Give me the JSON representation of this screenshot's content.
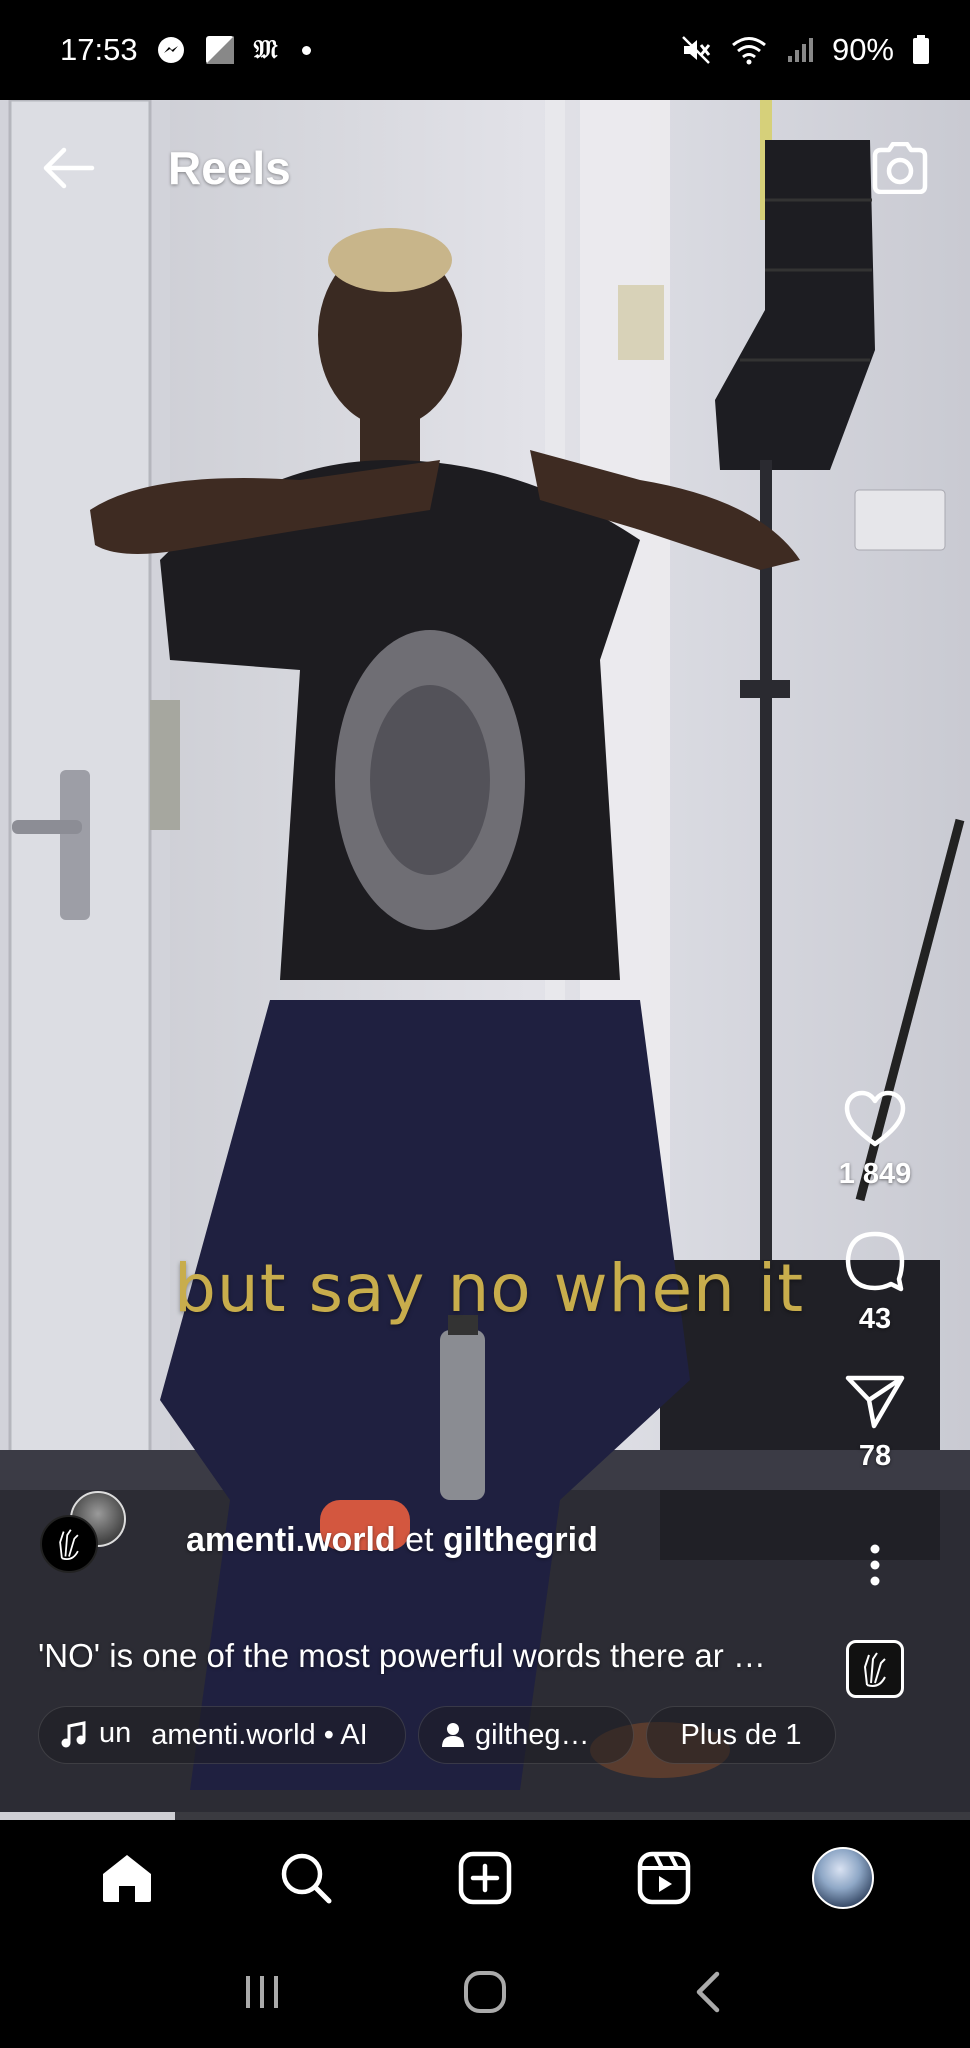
{
  "status_bar": {
    "time": "17:53",
    "m_icon": "𝔐",
    "battery_percent": "90%",
    "icons": [
      "messenger-icon",
      "flipboard-icon",
      "mute-icon",
      "wifi-icon",
      "signal-icon",
      "battery-icon"
    ]
  },
  "header": {
    "title": "Reels",
    "back_icon": "back-arrow-icon",
    "camera_icon": "camera-icon"
  },
  "video": {
    "subtitle": "but say no when it",
    "progress": 0.18
  },
  "actions": {
    "like_count": "1 849",
    "comment_count": "43",
    "share_count": "78"
  },
  "author": {
    "name1": "amenti.world",
    "conjunction": "et",
    "name2": "gilthegrid"
  },
  "description": "'NO' is one of the most powerful words there ar …",
  "chips": {
    "audio_prefix": "un",
    "audio_label": "amenti.world • AI",
    "user_label": "giltheg…",
    "more_label": "Plus de 1"
  },
  "colors": {
    "subtitle": "#c8ad4c",
    "background": "#000000"
  }
}
